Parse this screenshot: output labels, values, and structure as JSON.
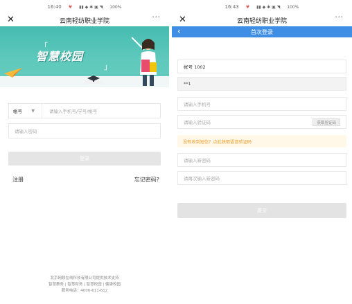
{
  "left": {
    "status": {
      "time": "16:40",
      "battery": "100%"
    },
    "title": "云南轻纺职业学院",
    "more": "···",
    "banner": {
      "slogan": "智慧校园"
    },
    "account_label": "帐号",
    "account_placeholder": "请输入手机号/学号/帐号",
    "password_placeholder": "请输入密码",
    "login_button": "登录",
    "register_link": "注册",
    "forgot_link": "忘记密码?",
    "footer": {
      "line1": "北京网联在线科技有限公司提供技术支持",
      "line2": "智慧教务 | 智慧财务 | 智慧校园 | 健康校园",
      "line3": "服务电话：4006-611-612"
    }
  },
  "right": {
    "status": {
      "time": "16:43",
      "battery": "100%"
    },
    "title": "云南轻纺职业学院",
    "more": "···",
    "page_title": "首次登录",
    "account_value": "帐号 1002",
    "password_value": "**1",
    "phone_placeholder": "请输入手机号",
    "code_placeholder": "请输入验证码",
    "get_code_button": "获取验证码",
    "sms_notice": "没有收到短信？点此获取语音验证码",
    "new_password_placeholder": "请输入新密码",
    "confirm_password_placeholder": "请再次输入新密码",
    "submit_button": "提交"
  },
  "colors": {
    "banner": "#46bbb0",
    "nav_blue": "#3e8ee6",
    "notice_orange": "#ef9a28",
    "disabled_button": "#e5e5e5"
  }
}
